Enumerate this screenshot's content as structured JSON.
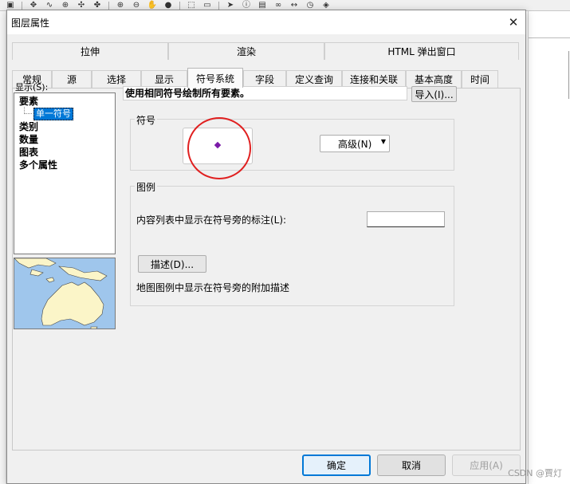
{
  "dialog": {
    "title": "图层属性",
    "close_glyph": "✕"
  },
  "tabs_top": [
    {
      "label": "拉伸"
    },
    {
      "label": "渲染"
    },
    {
      "label": "HTML 弹出窗口"
    }
  ],
  "tabs_bottom": [
    {
      "label": "常规"
    },
    {
      "label": "源"
    },
    {
      "label": "选择"
    },
    {
      "label": "显示"
    },
    {
      "label": "符号系统",
      "active": true
    },
    {
      "label": "字段"
    },
    {
      "label": "定义查询"
    },
    {
      "label": "连接和关联"
    },
    {
      "label": "基本高度"
    },
    {
      "label": "时间"
    }
  ],
  "show_panel": {
    "label": "显示(S):",
    "items": [
      {
        "label": "要素"
      },
      {
        "label": "单一符号",
        "selected": true
      },
      {
        "label": "类别"
      },
      {
        "label": "数量"
      },
      {
        "label": "图表"
      },
      {
        "label": "多个属性"
      }
    ]
  },
  "main": {
    "description": "使用相同符号绘制所有要素。",
    "import_button": "导入(I)...",
    "symbol_group": {
      "title": "符号",
      "advanced_button": "高级(N)",
      "symbol_color": "#7a1aa8"
    },
    "legend_group": {
      "title": "图例",
      "toc_label": "内容列表中显示在符号旁的标注(L):",
      "toc_value": "",
      "describe_button": "描述(D)...",
      "describe_note": "地图图例中显示在符号旁的附加描述"
    }
  },
  "footer": {
    "ok": "确定",
    "cancel": "取消",
    "apply": "应用(A)"
  },
  "watermark": "CSDN @賈灯",
  "colors": {
    "accent": "#0078d7",
    "highlight_circle": "#e02020"
  }
}
